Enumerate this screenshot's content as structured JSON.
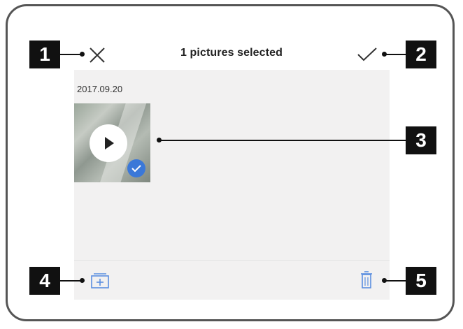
{
  "header": {
    "title": "1 pictures selected",
    "close_icon": "close-icon",
    "confirm_icon": "checkmark-icon"
  },
  "gallery": {
    "date": "2017.09.20",
    "items": [
      {
        "type": "video",
        "selected": true,
        "play_icon": "play-icon",
        "badge_icon": "check-badge-icon"
      }
    ]
  },
  "toolbar": {
    "add_icon": "add-to-album-icon",
    "delete_icon": "trash-icon"
  },
  "callouts": [
    "1",
    "2",
    "3",
    "4",
    "5"
  ],
  "colors": {
    "accent": "#3b78d8",
    "background": "#f2f1f1",
    "callout": "#111111"
  }
}
